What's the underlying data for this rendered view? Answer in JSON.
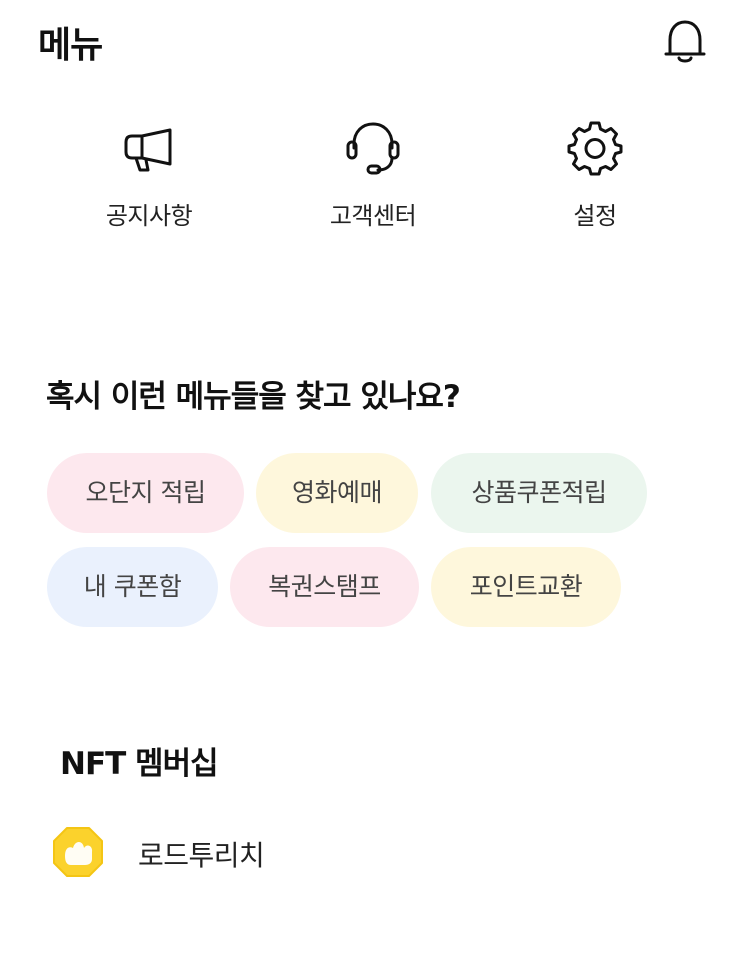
{
  "header": {
    "title": "메뉴",
    "bell_icon": "bell-icon"
  },
  "quick_menu": [
    {
      "label": "공지사항",
      "icon": "megaphone-icon"
    },
    {
      "label": "고객센터",
      "icon": "headset-icon"
    },
    {
      "label": "설정",
      "icon": "gear-icon"
    }
  ],
  "suggestions": {
    "title": "혹시 이런 메뉴들을 찾고 있나요?",
    "chips": [
      {
        "label": "오단지 적립",
        "color": "#fde8ee"
      },
      {
        "label": "영화예매",
        "color": "#fef7dc"
      },
      {
        "label": "상품쿠폰적립",
        "color": "#ebf6ee"
      },
      {
        "label": "내 쿠폰함",
        "color": "#eaf1fd"
      },
      {
        "label": "복권스탬프",
        "color": "#fde8ee"
      },
      {
        "label": "포인트교환",
        "color": "#fef7dc"
      }
    ]
  },
  "nft": {
    "title": "NFT 멤버십",
    "items": [
      {
        "label": "로드투리치",
        "icon": "gold-badge-icon",
        "color": "#fbd22c"
      }
    ]
  }
}
